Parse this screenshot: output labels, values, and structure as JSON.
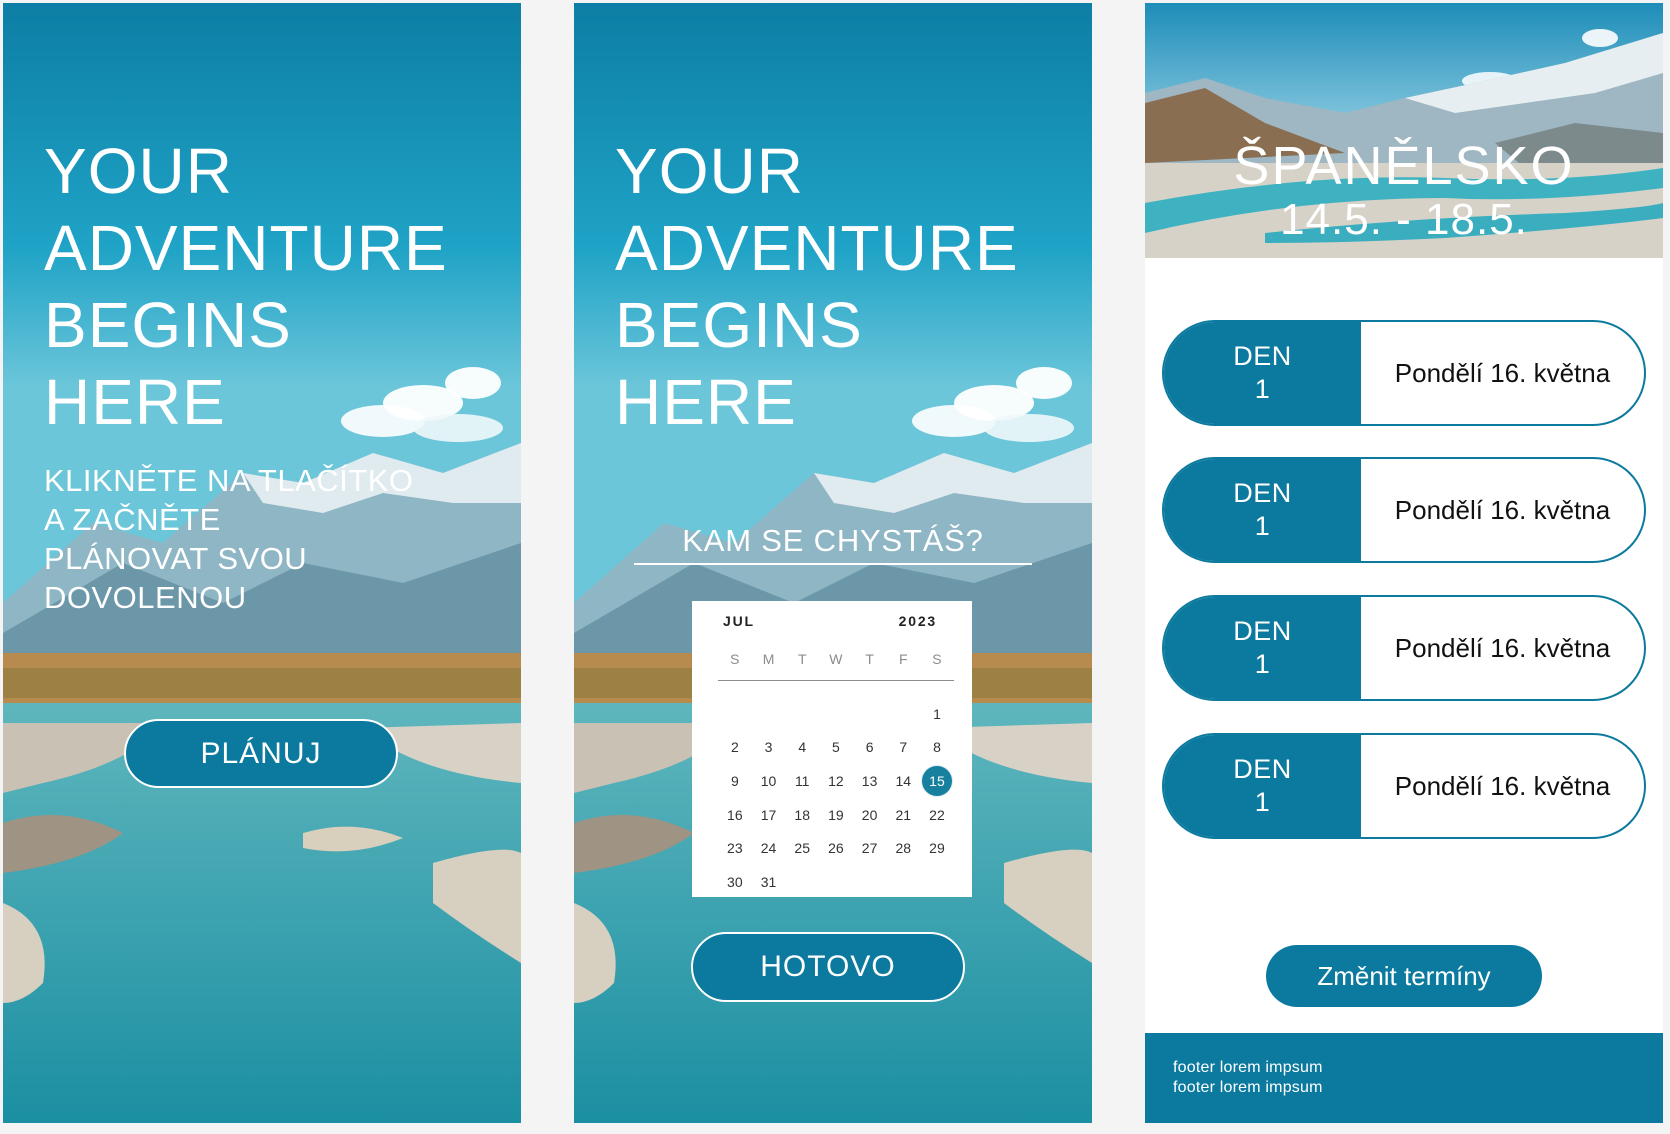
{
  "screen1": {
    "title_lines": [
      "YOUR",
      "ADVENTURE",
      "BEGINS",
      "HERE"
    ],
    "subtitle_lines": [
      "KLIKNĚTE NA TLAČÍTKO",
      "A ZAČNĚTE",
      "PLÁNOVAT SVOU",
      "DOVOLENOU"
    ],
    "plan_button_label": "PLÁNUJ"
  },
  "screen2": {
    "title_lines": [
      "YOUR",
      "ADVENTURE",
      "BEGINS",
      "HERE"
    ],
    "destination_question": "KAM SE CHYSTÁŠ?",
    "calendar": {
      "month": "JUL",
      "year": "2023",
      "weekdays": [
        "S",
        "M",
        "T",
        "W",
        "T",
        "F",
        "S"
      ],
      "leading_blank_days": 6,
      "days": [
        "1",
        "2",
        "3",
        "4",
        "5",
        "6",
        "7",
        "8",
        "9",
        "10",
        "11",
        "12",
        "13",
        "14",
        "15",
        "16",
        "17",
        "18",
        "19",
        "20",
        "21",
        "22",
        "23",
        "24",
        "25",
        "26",
        "27",
        "28",
        "29",
        "30",
        "31"
      ],
      "selected_day": "15"
    },
    "done_button_label": "HOTOVO"
  },
  "screen3": {
    "destination": "ŠPANĚLSKO",
    "dates": "14.5. - 18.5.",
    "day_cards": [
      {
        "label_line1": "DEN",
        "label_line2": "1",
        "date": "Pondělí 16. května"
      },
      {
        "label_line1": "DEN",
        "label_line2": "1",
        "date": "Pondělí 16. května"
      },
      {
        "label_line1": "DEN",
        "label_line2": "1",
        "date": "Pondělí 16. května"
      },
      {
        "label_line1": "DEN",
        "label_line2": "1",
        "date": "Pondělí 16. května"
      }
    ],
    "change_dates_button_label": "Změnit termíny",
    "footer_lines": [
      "footer lorem impsum",
      "footer lorem impsum"
    ]
  },
  "colors": {
    "brand": "#0c7a9f",
    "sky_top": "#0a7aa0",
    "water": "#2aa8b5",
    "background": "#f4f4f5"
  }
}
